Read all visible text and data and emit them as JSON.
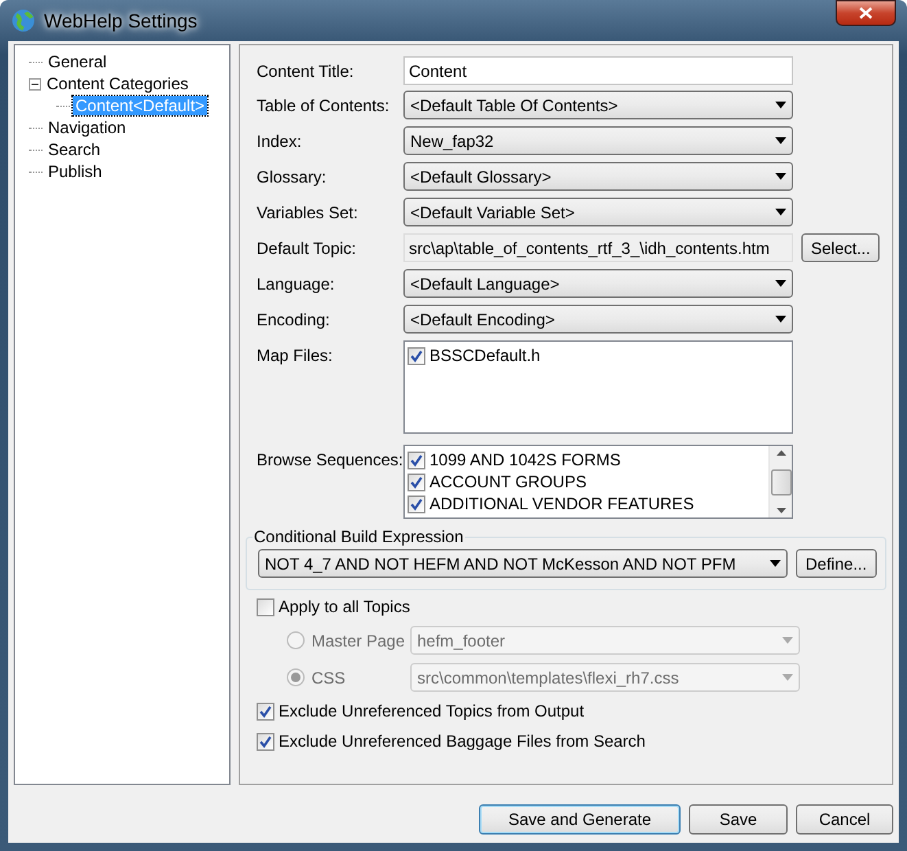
{
  "window": {
    "title": "WebHelp Settings"
  },
  "tree": [
    {
      "label": "General",
      "selected": false
    },
    {
      "label": "Content Categories",
      "selected": false,
      "expanded": true,
      "children": [
        {
          "label": "Content<Default>",
          "selected": true
        }
      ]
    },
    {
      "label": "Navigation",
      "selected": false
    },
    {
      "label": "Search",
      "selected": false
    },
    {
      "label": "Publish",
      "selected": false
    }
  ],
  "fields": [
    {
      "kind": "text",
      "label": "Content Title:",
      "value": "Content"
    },
    {
      "kind": "select",
      "label": "Table of Contents:",
      "value": "<Default Table Of Contents>"
    },
    {
      "kind": "select",
      "label": "Index:",
      "value": "New_fap32"
    },
    {
      "kind": "select",
      "label": "Glossary:",
      "value": "<Default Glossary>"
    },
    {
      "kind": "select",
      "label": "Variables Set:",
      "value": "<Default Variable Set>"
    },
    {
      "kind": "path",
      "label": "Default Topic:",
      "value": "src\\ap\\table_of_contents_rtf_3_\\idh_contents.htm",
      "button": "Select..."
    },
    {
      "kind": "select",
      "label": "Language:",
      "value": "<Default Language>"
    },
    {
      "kind": "select",
      "label": "Encoding:",
      "value": "<Default Encoding>"
    },
    {
      "kind": "list",
      "label": "Map Files:",
      "items": [
        {
          "label": "BSSCDefault.h",
          "checked": true
        }
      ]
    },
    {
      "kind": "scrolllist",
      "label": "Browse Sequences:",
      "items": [
        {
          "label": "1099 AND 1042S FORMS",
          "checked": true
        },
        {
          "label": "ACCOUNT GROUPS",
          "checked": true
        },
        {
          "label": "ADDITIONAL VENDOR FEATURES",
          "checked": true
        }
      ]
    }
  ],
  "conditional_build": {
    "legend": "Conditional Build Expression",
    "value": "NOT 4_7 AND NOT HEFM AND NOT McKesson AND NOT PFM",
    "button": "Define..."
  },
  "apply_to_all": {
    "label": "Apply to all Topics",
    "checked": false
  },
  "apply_options": [
    {
      "label": "Master Page",
      "selected": false,
      "disabled": true,
      "value": "hefm_footer"
    },
    {
      "label": "CSS",
      "selected": true,
      "disabled": true,
      "value": "src\\common\\templates\\flexi_rh7.css"
    }
  ],
  "excludes": [
    {
      "label": "Exclude Unreferenced Topics from Output",
      "checked": true
    },
    {
      "label": "Exclude Unreferenced Baggage Files from Search",
      "checked": true
    }
  ],
  "buttons": [
    {
      "label": "Save and Generate",
      "default": true
    },
    {
      "label": "Save",
      "default": false
    },
    {
      "label": "Cancel",
      "default": false
    }
  ]
}
